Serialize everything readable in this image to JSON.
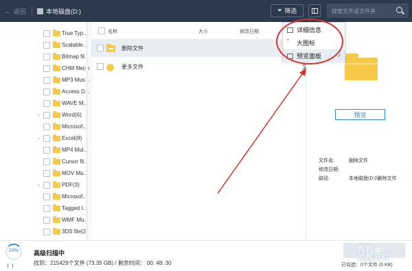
{
  "header": {
    "back_label": "返回",
    "drive_label": "本地磁盘(D:)",
    "filter_label": "筛选",
    "search_placeholder": "搜索文件或文件夹"
  },
  "tree": {
    "items": [
      {
        "label": "True Typ...",
        "expandable": false
      },
      {
        "label": "Scalable...",
        "expandable": false
      },
      {
        "label": "Bitmap fil...",
        "expandable": false
      },
      {
        "label": "CHM file(4)",
        "expandable": false
      },
      {
        "label": "MP3 Mus...",
        "expandable": false
      },
      {
        "label": "Access D...",
        "expandable": false
      },
      {
        "label": "WAVE M...",
        "expandable": false
      },
      {
        "label": "Word(6)",
        "expandable": true
      },
      {
        "label": "Microsof...",
        "expandable": false
      },
      {
        "label": "Excel(8)",
        "expandable": true
      },
      {
        "label": "MP4 Mul...",
        "expandable": false
      },
      {
        "label": "Cursor fil...",
        "expandable": false
      },
      {
        "label": "MOV Mu...",
        "expandable": false
      },
      {
        "label": "PDF(3)",
        "expandable": true
      },
      {
        "label": "Microsof...",
        "expandable": false
      },
      {
        "label": "Tagged I...",
        "expandable": false
      },
      {
        "label": "WMF Mu...",
        "expandable": false
      },
      {
        "label": "3DS file(2...",
        "expandable": false
      }
    ]
  },
  "list": {
    "columns": {
      "name": "名称",
      "size": "大小",
      "modified": "修改日期"
    },
    "rows": [
      {
        "name": "删除文件",
        "type": "",
        "selected": true
      },
      {
        "name": "更多文件",
        "type": "文",
        "selected": false
      }
    ]
  },
  "view_menu": {
    "items": [
      {
        "label": "详细信息",
        "checked": false
      },
      {
        "label": "大图标",
        "checked": false
      },
      {
        "label": "预览面板",
        "checked": true
      }
    ]
  },
  "preview": {
    "button_label": "预览",
    "meta": [
      {
        "key": "文件名:",
        "value": "删除文件"
      },
      {
        "key": "修改日期:",
        "value": ""
      },
      {
        "key": "路径:",
        "value": "本地磁盘(D:)\\删除文件"
      }
    ]
  },
  "status": {
    "progress_percent": "24%",
    "progress_value": 0.24,
    "pause_glyph": "❙❙",
    "title": "高级扫描中",
    "found_info": "找到：215429个文件 (73.35 GB) / 剩余时间：  00: 48: 30",
    "recover_label": "恢复",
    "selected_info": "已勾选：0个文件 (0 KB)",
    "watermark": "教育\n爱教软件"
  },
  "colors": {
    "topbar": "#2c3a4e",
    "accent": "#2e8bd9",
    "folder": "#f7c948",
    "annotation": "#d9302a"
  }
}
